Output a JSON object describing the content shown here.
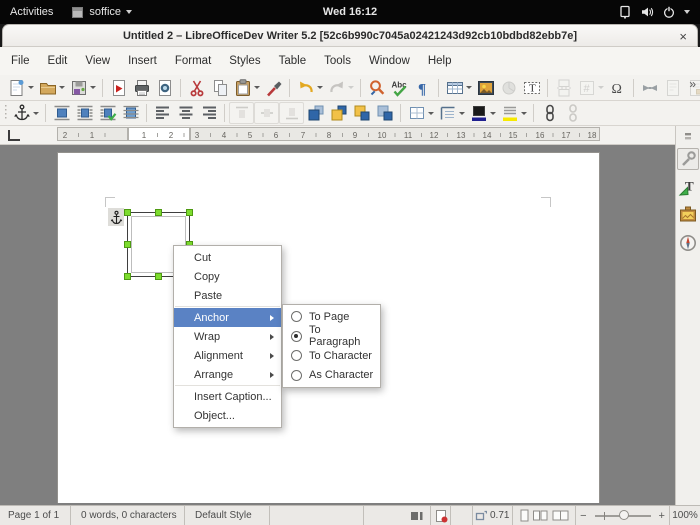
{
  "topbar": {
    "activities": "Activities",
    "app_name": "soffice",
    "clock": "Wed 16:12"
  },
  "titlebar": {
    "title": "Untitled 2 – LibreOfficeDev Writer 5.2 [52c6b990c7045a02421243d92cb10bdbd82ebb7e]",
    "close_label": "×"
  },
  "menubar": {
    "items": [
      "File",
      "Edit",
      "View",
      "Insert",
      "Format",
      "Styles",
      "Table",
      "Tools",
      "Window",
      "Help"
    ]
  },
  "toolbar_main": {
    "overflow_label": "»",
    "icons": [
      "new-document",
      "open",
      "save",
      "export-pdf",
      "print",
      "print-preview",
      "cut",
      "copy",
      "paste",
      "clone-formatting",
      "undo",
      "redo",
      "find-and-replace",
      "spelling",
      "formatting-marks",
      "insert-table",
      "insert-image",
      "insert-chart",
      "insert-text-box",
      "insert-page-break",
      "insert-field",
      "special-character",
      "insert-hyperlink",
      "insert-footnote",
      "insert-endnote"
    ]
  },
  "toolbar_frame": {
    "icons": [
      "anchor",
      "wrap-off",
      "wrap-parallel",
      "wrap-optimal",
      "wrap-through",
      "align-left",
      "align-center",
      "align-right",
      "align-top",
      "align-middle",
      "align-bottom",
      "bring-to-front",
      "forward-one",
      "back-one",
      "send-to-back",
      "borders",
      "border-style",
      "border-color",
      "background-color",
      "link-frames",
      "unlink-frames"
    ]
  },
  "ruler": {
    "left_numbers": [
      "2",
      "1"
    ],
    "numbers": [
      "1",
      "2",
      "3",
      "4",
      "5",
      "6",
      "7",
      "8",
      "9",
      "10",
      "11",
      "12",
      "13",
      "14",
      "15",
      "16",
      "17",
      "18"
    ]
  },
  "context_menu": {
    "items": [
      {
        "label": "Cut",
        "has_submenu": false,
        "highlighted": false
      },
      {
        "label": "Copy",
        "has_submenu": false,
        "highlighted": false
      },
      {
        "label": "Paste",
        "has_submenu": false,
        "highlighted": false
      },
      {
        "label": "Anchor",
        "has_submenu": true,
        "highlighted": true
      },
      {
        "label": "Wrap",
        "has_submenu": true,
        "highlighted": false
      },
      {
        "label": "Alignment",
        "has_submenu": true,
        "highlighted": false
      },
      {
        "label": "Arrange",
        "has_submenu": true,
        "highlighted": false
      },
      {
        "label": "Insert Caption...",
        "has_submenu": false,
        "highlighted": false
      },
      {
        "label": "Object...",
        "has_submenu": false,
        "highlighted": false
      }
    ]
  },
  "anchor_submenu": {
    "items": [
      {
        "label": "To Page",
        "selected": false
      },
      {
        "label": "To Paragraph",
        "selected": true
      },
      {
        "label": "To Character",
        "selected": false
      },
      {
        "label": "As Character",
        "selected": false
      }
    ]
  },
  "sidebar": {
    "icons": [
      "sidebar-settings",
      "properties",
      "styles-and-formatting",
      "gallery",
      "navigator"
    ]
  },
  "statusbar": {
    "page_info": "Page 1 of 1",
    "word_count": "0 words, 0 characters",
    "page_style": "Default Style",
    "object_size": "0.71",
    "zoom_level": "100%"
  },
  "colors": {
    "menu_highlight": "#5a82c4",
    "selection_handle_green": "#7ddc2e",
    "accent_blue": "#3465a4",
    "topbar_bg": "#060606",
    "workspace_gray": "#7f7f7f"
  }
}
